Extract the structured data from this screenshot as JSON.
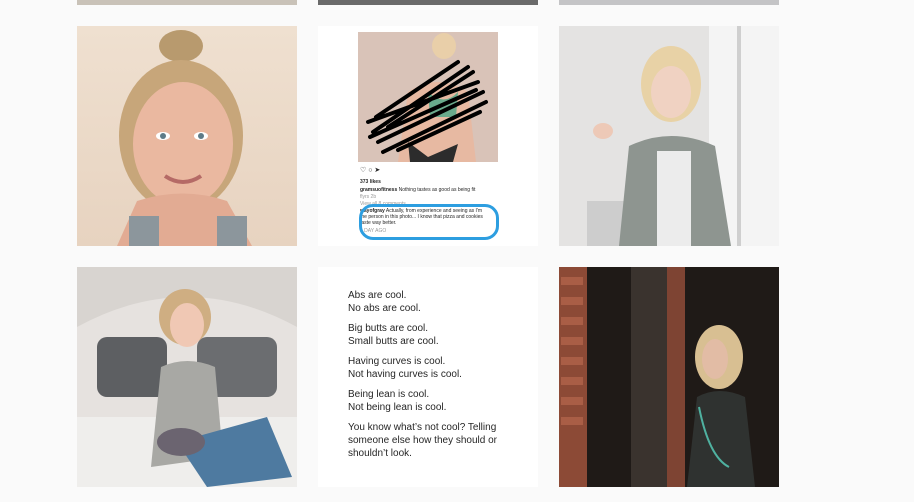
{
  "grid": {
    "tiles": [
      {
        "alt": "Portrait smiling woman with top bun"
      },
      {
        "alt": "Instagram screenshot with scribbled out photo"
      },
      {
        "alt": "Woman in grey cardigan by window"
      },
      {
        "alt": "Woman sitting on bed"
      },
      {
        "alt": "Text post about body image"
      },
      {
        "alt": "Woman by dark window with brick wall"
      }
    ]
  },
  "instagram_post": {
    "likes": "373 likes",
    "caption_user": "gramsuofitness",
    "caption_text": "Nothing tastes as good as being fit",
    "caption_meta": "flyrs 2b",
    "view_comments": "View all 8 comments",
    "comment_user": "wayofgray",
    "comment_text": "Actually, from experience and seeing as I'm the person in this photo... I know that pizza and cookies taste way better.",
    "timestamp": "1 DAY AGO"
  },
  "text_post": {
    "lines": [
      [
        "Abs are cool.",
        "No abs are cool."
      ],
      [
        "Big butts are cool.",
        "Small butts are cool."
      ],
      [
        "Having curves is cool.",
        "Not having curves is cool."
      ],
      [
        "Being lean is cool.",
        "Not being lean is cool."
      ],
      [
        "You know what’s not cool? Telling someone else how they should or shouldn’t look."
      ]
    ]
  },
  "colors": {
    "background": "#fafafa",
    "highlight_blue": "#2d9ee0",
    "scribble": "#000000"
  }
}
